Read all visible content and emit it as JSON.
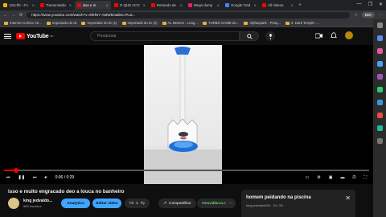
{
  "browser": {
    "tabs": [
      {
        "label": "12m:hb - Fo",
        "color": "#f4b400"
      },
      {
        "label": "Transmissão",
        "color": "#ff0000"
      },
      {
        "label": "isso e m",
        "color": "#ff0000"
      },
      {
        "label": "O QUE ACO",
        "color": "#ff0000"
      },
      {
        "label": "Entrando de",
        "color": "#ff0000"
      },
      {
        "label": "Mega dump",
        "color": "#e91e63"
      },
      {
        "label": "Google Trad",
        "color": "#4285f4"
      },
      {
        "label": "All Videos",
        "color": "#ff0000"
      }
    ],
    "new_tab_label": "+",
    "url": "https://www.youtube.com/watch?v=9lKfN7-AMWbm&list=PLai...",
    "profile_label": "Bee",
    "window_controls": [
      "—",
      "❐",
      "✕"
    ]
  },
  "bookmarks": [
    "Internet Archive: Di...",
    "Importado do IE",
    "Importado do IE (1)",
    "Importado do IE (2)",
    "AL Memes - Long...",
    "TURBO GAME de...",
    "Alphaspark - Pesq...",
    "2. Dark Temple -..."
  ],
  "youtube": {
    "logo_text": "YouTube",
    "logo_country": "BR",
    "search_placeholder": "Pesquisar"
  },
  "player": {
    "time_current": "0:06",
    "time_total": "0:29",
    "time_separator": "/",
    "progress_fraction": 0.03
  },
  "video": {
    "title": "isso e muito engracado deo a louca no banheiro",
    "channel_name": "king jedvaldo...",
    "channel_subs": "883 inscritos",
    "analytics_label": "Analytics",
    "edit_label": "Editar vídeo",
    "like_count": "1",
    "share_label": "Compartilhar",
    "watermark": "meuvidlarca.com"
  },
  "panel": {
    "title": "homem peidando na piscina",
    "subtitle": "king jedvaldo594 - 24 / 50"
  },
  "colors": {
    "yt_red": "#ff0000",
    "accent_blue": "#3ea6ff"
  }
}
